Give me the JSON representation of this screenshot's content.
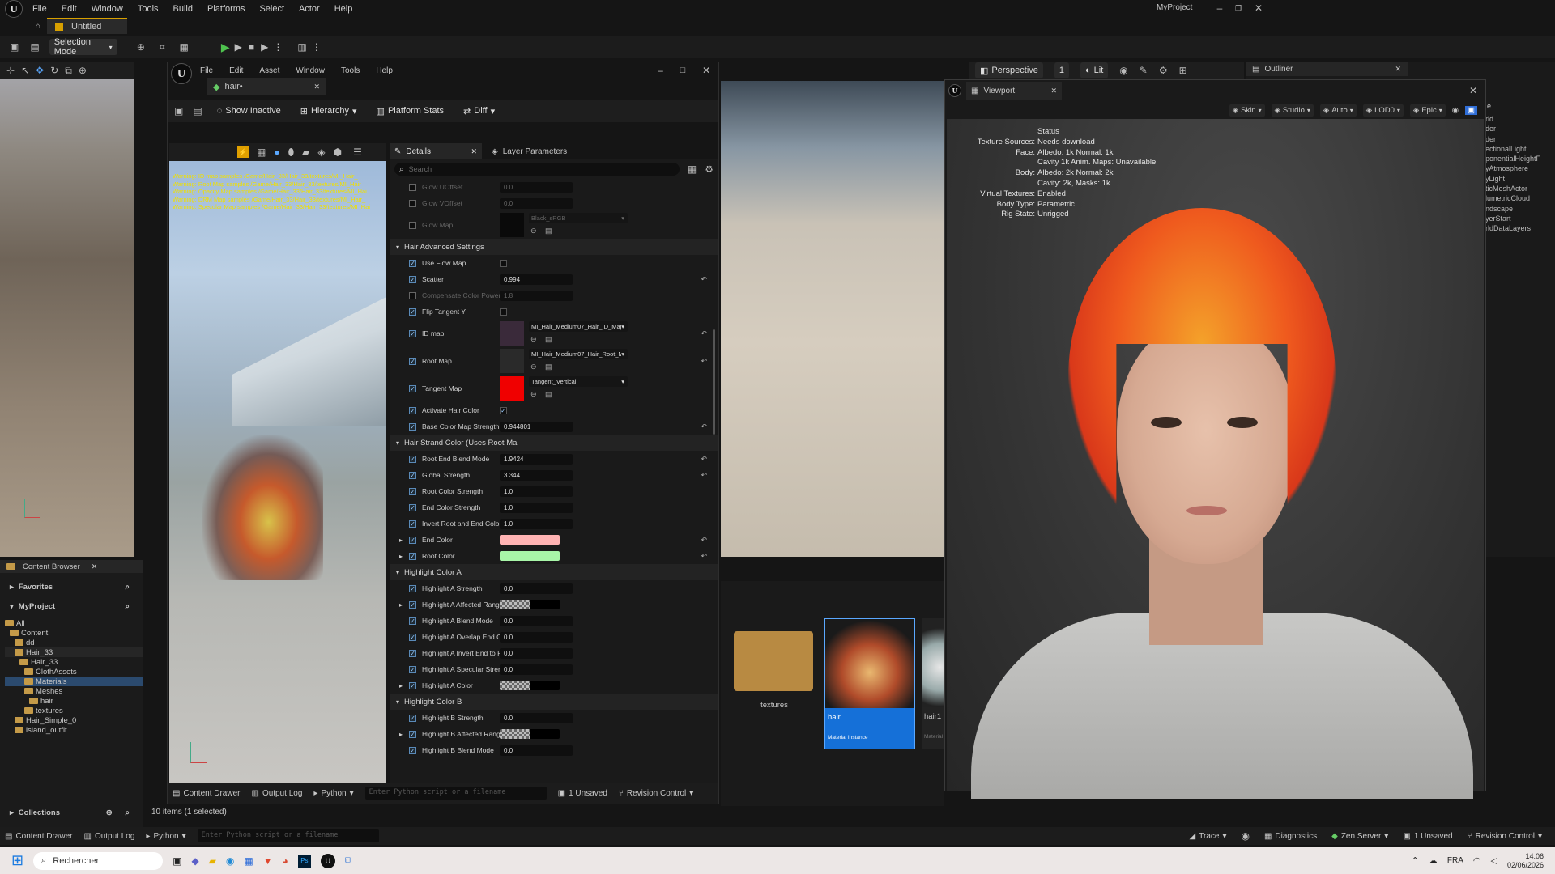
{
  "app": {
    "menu": [
      "File",
      "Edit",
      "Window",
      "Tools",
      "Build",
      "Platforms",
      "Select",
      "Actor",
      "Help"
    ],
    "project": "MyProject",
    "level_tab": "Untitled",
    "selection_mode": "Selection Mode"
  },
  "viewport_bar": {
    "perspective": "Perspective",
    "lit": "Lit",
    "num": "1"
  },
  "outliner": {
    "title": "Outliner",
    "items": [
      "rld",
      "der",
      "der",
      "ectionalLight",
      "ponentialHeightF",
      "yAtmosphere",
      "yLight",
      "ticMeshActor",
      "lumetricCloud",
      "ndscape",
      "yerStart",
      "rldDataLayers"
    ],
    "header": "e"
  },
  "content_browser": {
    "title": "Content Browser",
    "favorites": "Favorites",
    "project": "MyProject",
    "tree": [
      "All",
      "Content",
      "dd",
      "Hair_33",
      "Hair_33",
      "ClothAssets",
      "Materials",
      "Meshes",
      "hair",
      "textures",
      "Hair_Simple_0",
      "island_outfit"
    ],
    "collections": "Collections",
    "items_count": "10 items (1 selected)",
    "assets": [
      {
        "name": "textures",
        "type": ""
      },
      {
        "name": "hair",
        "type": "Material Instance"
      },
      {
        "name": "hair1",
        "type": "Material"
      }
    ]
  },
  "mat_editor": {
    "menu": [
      "File",
      "Edit",
      "Asset",
      "Window",
      "Tools",
      "Help"
    ],
    "tab": "hair•",
    "toolbar": [
      "Show Inactive",
      "Hierarchy",
      "Platform Stats",
      "Diff"
    ],
    "warnings": [
      "Warning: ID map samples /Game/Hair_33/Hair_33/textures/MI_Hair_",
      "Warning: Root Map samples /Game/Hair_33/Hair_33/textures/MI_Hair",
      "Warning: Opacity Map samples /Game/Hair_33/Hair_33/textures/MI_Hai",
      "Warning: DRM Map samples /Game/Hair_33/Hair_33/textures/MI_Hair_",
      "Warning: Specular Map samples /Game/Hair_33/Hair_33/textures/MI_Hai"
    ],
    "details_tab": "Details",
    "layer_tab": "Layer Parameters",
    "search_placeholder": "Search",
    "rows": [
      {
        "k": "p",
        "label": "Glow UOffset",
        "val": "0.0",
        "dim": true,
        "chk": false
      },
      {
        "k": "p",
        "label": "Glow VOffset",
        "val": "0.0",
        "dim": true,
        "chk": false
      },
      {
        "k": "tex",
        "label": "Glow Map",
        "val": "Black_sRGB",
        "dim": true,
        "chk": false,
        "sw": "#0a0a0a"
      },
      {
        "k": "s",
        "label": "Hair Advanced Settings"
      },
      {
        "k": "b",
        "label": "Use Flow Map",
        "chk": true,
        "box": false
      },
      {
        "k": "p",
        "label": "Scatter",
        "val": "0.994",
        "chk": true,
        "reset": true
      },
      {
        "k": "p",
        "label": "Compensate Color Power",
        "val": "1.8",
        "dim": true,
        "chk": false
      },
      {
        "k": "b",
        "label": "Flip Tangent Y",
        "chk": true,
        "box": false
      },
      {
        "k": "tex",
        "label": "ID map",
        "val": "MI_Hair_Medium07_Hair_ID_Map",
        "chk": true,
        "reset": true,
        "sw": "#3a2a3a"
      },
      {
        "k": "tex",
        "label": "Root Map",
        "val": "MI_Hair_Medium07_Hair_Root_Map",
        "chk": true,
        "reset": true,
        "sw": "#2a2a2a"
      },
      {
        "k": "tex",
        "label": "Tangent Map",
        "val": "Tangent_Vertical",
        "chk": true,
        "sw": "#f00000"
      },
      {
        "k": "b",
        "label": "Activate Hair Color",
        "chk": true,
        "box": true
      },
      {
        "k": "p",
        "label": "Base Color Map Strength",
        "val": "0.944801",
        "chk": true,
        "reset": true
      },
      {
        "k": "s",
        "label": "Hair Strand Color (Uses Root Ma"
      },
      {
        "k": "p",
        "label": "Root End Blend Mode",
        "val": "1.9424",
        "chk": true,
        "reset": true
      },
      {
        "k": "p",
        "label": "Global Strength",
        "val": "3.344",
        "chk": true,
        "reset": true
      },
      {
        "k": "p",
        "label": "Root Color Strength",
        "val": "1.0",
        "chk": true
      },
      {
        "k": "p",
        "label": "End Color Strength",
        "val": "1.0",
        "chk": true
      },
      {
        "k": "p",
        "label": "Invert Root and End Color",
        "val": "1.0",
        "chk": true
      },
      {
        "k": "c",
        "label": "End Color",
        "chk": true,
        "reset": true,
        "col": "#ffb3b3"
      },
      {
        "k": "c",
        "label": "Root Color",
        "chk": true,
        "reset": true,
        "col": "#a8f5a8"
      },
      {
        "k": "s",
        "label": "Highlight Color A"
      },
      {
        "k": "p",
        "label": "Highlight A Strength",
        "val": "0.0",
        "chk": true
      },
      {
        "k": "c",
        "label": "Highlight A Affected Range",
        "chk": true,
        "col": "checker"
      },
      {
        "k": "p",
        "label": "Highlight A Blend Mode",
        "val": "0.0",
        "chk": true
      },
      {
        "k": "p",
        "label": "Highlight A Overlap End Color",
        "val": "0.0",
        "chk": true
      },
      {
        "k": "p",
        "label": "Highlight A Invert End to Ro...",
        "val": "0.0",
        "chk": true
      },
      {
        "k": "p",
        "label": "Highlight A Specular Strength",
        "val": "0.0",
        "chk": true
      },
      {
        "k": "c",
        "label": "Highlight A Color",
        "chk": true,
        "col": "checker"
      },
      {
        "k": "s",
        "label": "Highlight Color B"
      },
      {
        "k": "p",
        "label": "Highlight B Strength",
        "val": "0.0",
        "chk": true
      },
      {
        "k": "c",
        "label": "Highlight B Affected Range",
        "chk": true,
        "col": "checker"
      },
      {
        "k": "p",
        "label": "Highlight B Blend Mode",
        "val": "0.0",
        "chk": true
      }
    ],
    "bottom": {
      "drawer": "Content Drawer",
      "log": "Output Log",
      "python": "Python",
      "placeholder": "Enter Python script or a filename",
      "unsaved": "1 Unsaved",
      "rc": "Revision Control"
    }
  },
  "viewport2": {
    "title": "Viewport",
    "toolbar": [
      "Skin",
      "Studio",
      "Auto",
      "LOD0",
      "Epic"
    ],
    "status": [
      [
        "",
        "Status"
      ],
      [
        "Texture Sources:",
        "Needs download"
      ],
      [
        "Face:",
        "Albedo: 1k Normal: 1k"
      ],
      [
        "",
        "Cavity 1k Anim. Maps: Unavailable"
      ],
      [
        "Body:",
        "Albedo: 2k Normal: 2k"
      ],
      [
        "",
        "Cavity: 2k, Masks: 1k"
      ],
      [
        "Virtual Textures:",
        "Enabled"
      ],
      [
        "Body Type:",
        "Parametric"
      ],
      [
        "Rig State:",
        "Unrigged"
      ]
    ]
  },
  "statusbar": {
    "drawer": "Content Drawer",
    "log": "Output Log",
    "python": "Python",
    "placeholder": "Enter Python script or a filename",
    "trace": "Trace",
    "diag": "Diagnostics",
    "zen": "Zen Server",
    "unsaved": "1 Unsaved",
    "rc": "Revision Control"
  },
  "taskbar": {
    "search": "Rechercher",
    "lang": "FRA",
    "time": "14:06",
    "date": "02/06/2026"
  }
}
